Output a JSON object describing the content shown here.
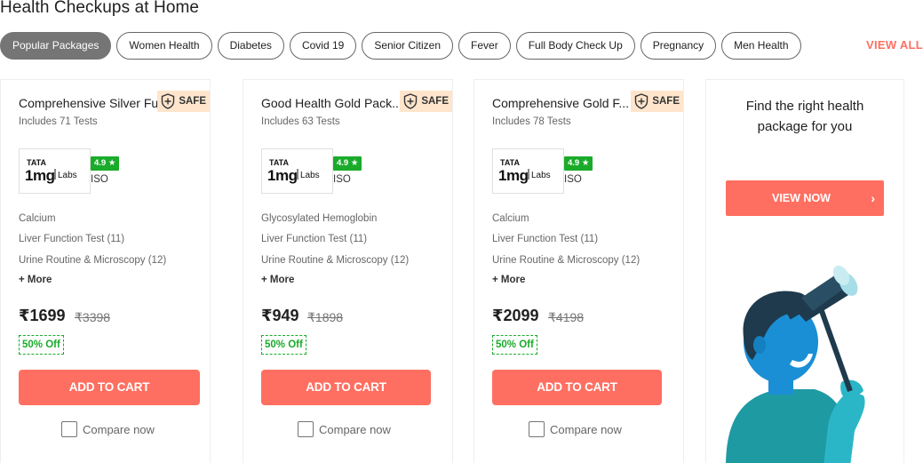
{
  "heading": "Health Checkups at Home",
  "chips": [
    "Popular Packages",
    "Women Health",
    "Diabetes",
    "Covid 19",
    "Senior Citizen",
    "Fever",
    "Full Body Check Up",
    "Pregnancy",
    "Men Health"
  ],
  "view_all": "VIEW ALL",
  "cards": [
    {
      "title": "Comprehensive Silver Ful...",
      "safe": "SAFE",
      "tests": "Includes 71 Tests",
      "lab_logo_top": "TATA",
      "lab_logo_main": "1mg",
      "lab_logo_sub": "Labs",
      "rating": "4.9 ★",
      "iso": "ISO",
      "inclusions": [
        "Calcium",
        "Liver Function Test (11)",
        "Urine Routine & Microscopy (12)"
      ],
      "more": "+ More",
      "price": "₹1699",
      "mrp": "₹3398",
      "discount": "50% Off",
      "add_to_cart": "ADD TO CART",
      "compare": "Compare now"
    },
    {
      "title": "Good Health Gold Pack...",
      "safe": "SAFE",
      "tests": "Includes 63 Tests",
      "lab_logo_top": "TATA",
      "lab_logo_main": "1mg",
      "lab_logo_sub": "Labs",
      "rating": "4.9 ★",
      "iso": "ISO",
      "inclusions": [
        "Glycosylated Hemoglobin",
        "Liver Function Test (11)",
        "Urine Routine & Microscopy (12)"
      ],
      "more": "+ More",
      "price": "₹949",
      "mrp": "₹1898",
      "discount": "50% Off",
      "add_to_cart": "ADD TO CART",
      "compare": "Compare now"
    },
    {
      "title": "Comprehensive Gold F...",
      "safe": "SAFE",
      "tests": "Includes 78 Tests",
      "lab_logo_top": "TATA",
      "lab_logo_main": "1mg",
      "lab_logo_sub": "Labs",
      "rating": "4.9 ★",
      "iso": "ISO",
      "inclusions": [
        "Calcium",
        "Liver Function Test (11)",
        "Urine Routine & Microscopy (12)"
      ],
      "more": "+ More",
      "price": "₹2099",
      "mrp": "₹4198",
      "discount": "50% Off",
      "add_to_cart": "ADD TO CART",
      "compare": "Compare now"
    }
  ],
  "promo": {
    "line1": "Find the right health",
    "line2": "package for you",
    "button": "VIEW NOW",
    "chevron": "›"
  },
  "colors": {
    "accent": "#ff6f61",
    "rating_green": "#1aab2a",
    "safe_bg": "#ffe5cc",
    "chip_active": "#757575"
  },
  "icons": {
    "safe": "shield-plus-icon",
    "compare": "checkbox-icon",
    "view_now": "chevron-right-icon"
  }
}
